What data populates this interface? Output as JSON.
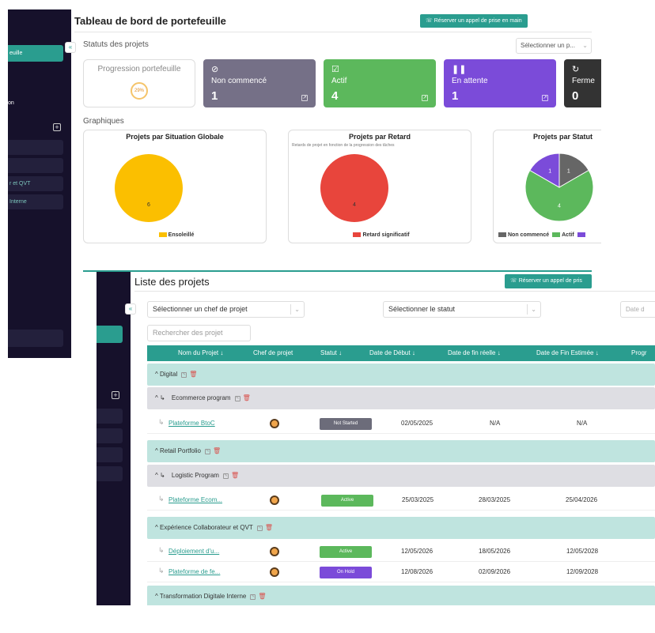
{
  "back": {
    "sidebar": {
      "items": [
        "euille",
        "",
        "r et QVT",
        "Interne"
      ],
      "label": "on"
    },
    "title": "Tableau de bord de portefeuille",
    "book_button": "Réserver un appel de prise en main",
    "statuts_title": "Statuts des projets",
    "select_placeholder": "Sélectionner un p...",
    "progress": {
      "label": "Progression portefeuille",
      "value": "29%"
    },
    "stats": [
      {
        "label": "Non commencé",
        "count": "1",
        "color": "#757087",
        "icon": "slash-icon"
      },
      {
        "label": "Actif",
        "count": "4",
        "color": "#5cb85c",
        "icon": "check-icon"
      },
      {
        "label": "En attente",
        "count": "1",
        "color": "#7b4bd9",
        "icon": "pause-icon"
      },
      {
        "label": "Ferme",
        "count": "0",
        "color": "#333333",
        "icon": "refresh-icon"
      }
    ],
    "graphiques_title": "Graphiques",
    "charts": [
      {
        "title": "Projets par Situation Globale",
        "subtitle": "",
        "legend": [
          {
            "name": "Ensoleillé",
            "color": "#fbbf00"
          }
        ],
        "slices": [
          {
            "value": 6,
            "color": "#fbbf00",
            "label": "6"
          }
        ]
      },
      {
        "title": "Projets par Retard",
        "subtitle": "Retards de projet en fonction de la progression des tâches",
        "legend": [
          {
            "name": "Retard significatif",
            "color": "#e8453c"
          }
        ],
        "slices": [
          {
            "value": 4,
            "color": "#e8453c",
            "label": "4"
          }
        ]
      },
      {
        "title": "Projets par Statut",
        "subtitle": "",
        "legend": [
          {
            "name": "Non commencé",
            "color": "#666666"
          },
          {
            "name": "Actif",
            "color": "#5cb85c"
          },
          {
            "name": "",
            "color": "#7b4bd9"
          }
        ],
        "slices": [
          {
            "value": 1,
            "color": "#666666",
            "label": "1"
          },
          {
            "value": 4,
            "color": "#5cb85c",
            "label": "4"
          },
          {
            "value": 1,
            "color": "#7b4bd9",
            "label": "1"
          }
        ]
      }
    ]
  },
  "front": {
    "title": "Liste des projets",
    "book_button": "Réserver un appel de pris",
    "chef_select": "Sélectionner un chef de projet",
    "statut_select": "Sélectionner le statut",
    "date_placeholder": "Date d",
    "search_placeholder": "Rechercher des projet",
    "columns": [
      "Nom du Projet ↓",
      "Chef de projet",
      "Statut ↓",
      "Date de Début ↓",
      "Date de fin réelle ↓",
      "Date de Fin Estimée ↓",
      "Progr"
    ],
    "groups": {
      "digital": "Digital",
      "ecommerce": "Ecommerce program",
      "retail": "Retail Portfolio",
      "logistic": "Logistic Program",
      "experience": "Expérience Collaborateur et QVT",
      "transformation": "Transformation Digitale Interne"
    },
    "rows": [
      {
        "name": "Plateforme BtoC",
        "status": "Not Started",
        "status_color": "#6c6c7a",
        "start": "02/05/2025",
        "end_real": "N/A",
        "end_est": "N/A"
      },
      {
        "name": "Plateforme Ecom...",
        "status": "Active",
        "status_color": "#5cb85c",
        "start": "25/03/2025",
        "end_real": "28/03/2025",
        "end_est": "25/04/2026"
      },
      {
        "name": "Déploiement d'u...",
        "status": "Active",
        "status_color": "#5cb85c",
        "start": "12/05/2026",
        "end_real": "18/05/2026",
        "end_est": "12/05/2028"
      },
      {
        "name": "Plateforme de fe...",
        "status": "On Hold",
        "status_color": "#7b4bd9",
        "start": "12/08/2026",
        "end_real": "02/09/2026",
        "end_est": "12/09/2028"
      }
    ]
  }
}
